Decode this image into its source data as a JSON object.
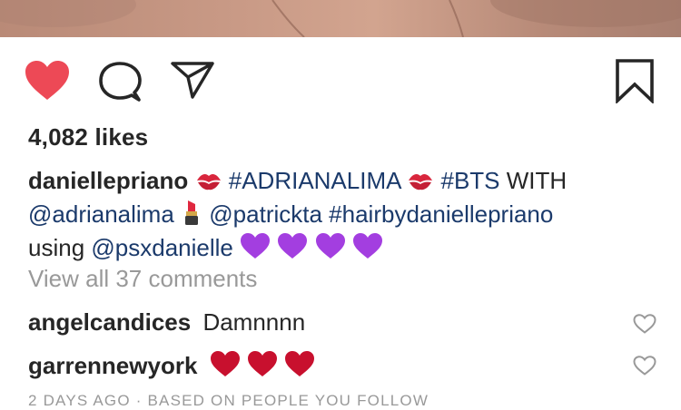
{
  "post": {
    "likes_text": "4,082 likes",
    "caption": {
      "username": "danielleprianο",
      "line1": [
        {
          "type": "user",
          "text": "daniellepriano"
        },
        {
          "type": "emoji",
          "icon": "kiss-mark-icon"
        },
        {
          "type": "tag",
          "text": "#ADRIANALIMA"
        },
        {
          "type": "emoji",
          "icon": "kiss-mark-icon"
        },
        {
          "type": "tag",
          "text": "#BTS"
        },
        {
          "type": "plain",
          "text": "WITH"
        }
      ],
      "line2": [
        {
          "type": "tag",
          "text": "@adrianalima"
        },
        {
          "type": "emoji",
          "icon": "lipstick-icon"
        },
        {
          "type": "tag",
          "text": "@patrickta"
        },
        {
          "type": "tag",
          "text": "#hairbydaniellepriano"
        }
      ],
      "line3": [
        {
          "type": "plain",
          "text": "using"
        },
        {
          "type": "tag",
          "text": "@psxdanielle"
        },
        {
          "type": "emoji",
          "icon": "purple-heart-icon"
        },
        {
          "type": "emoji",
          "icon": "purple-heart-icon"
        },
        {
          "type": "emoji",
          "icon": "purple-heart-icon"
        },
        {
          "type": "emoji",
          "icon": "purple-heart-icon"
        }
      ]
    },
    "view_all_comments": "View all 37 comments",
    "comments": [
      {
        "username": "angelcandices",
        "text": "Damnnnn",
        "emojis": []
      },
      {
        "username": "garrennewyork",
        "text": "",
        "emojis": [
          "red-heart-icon",
          "red-heart-icon",
          "red-heart-icon"
        ]
      }
    ],
    "timestamp": "2 DAYS AGO · BASED ON PEOPLE YOU FOLLOW"
  },
  "actions": {
    "like_icon": "heart-filled-icon",
    "comment_icon": "speech-bubble-icon",
    "share_icon": "paper-plane-icon",
    "save_icon": "bookmark-icon"
  },
  "colors": {
    "like_red": "#ed4956",
    "tag_blue": "#1b3a6b",
    "muted_gray": "#999999",
    "text": "#262626"
  }
}
